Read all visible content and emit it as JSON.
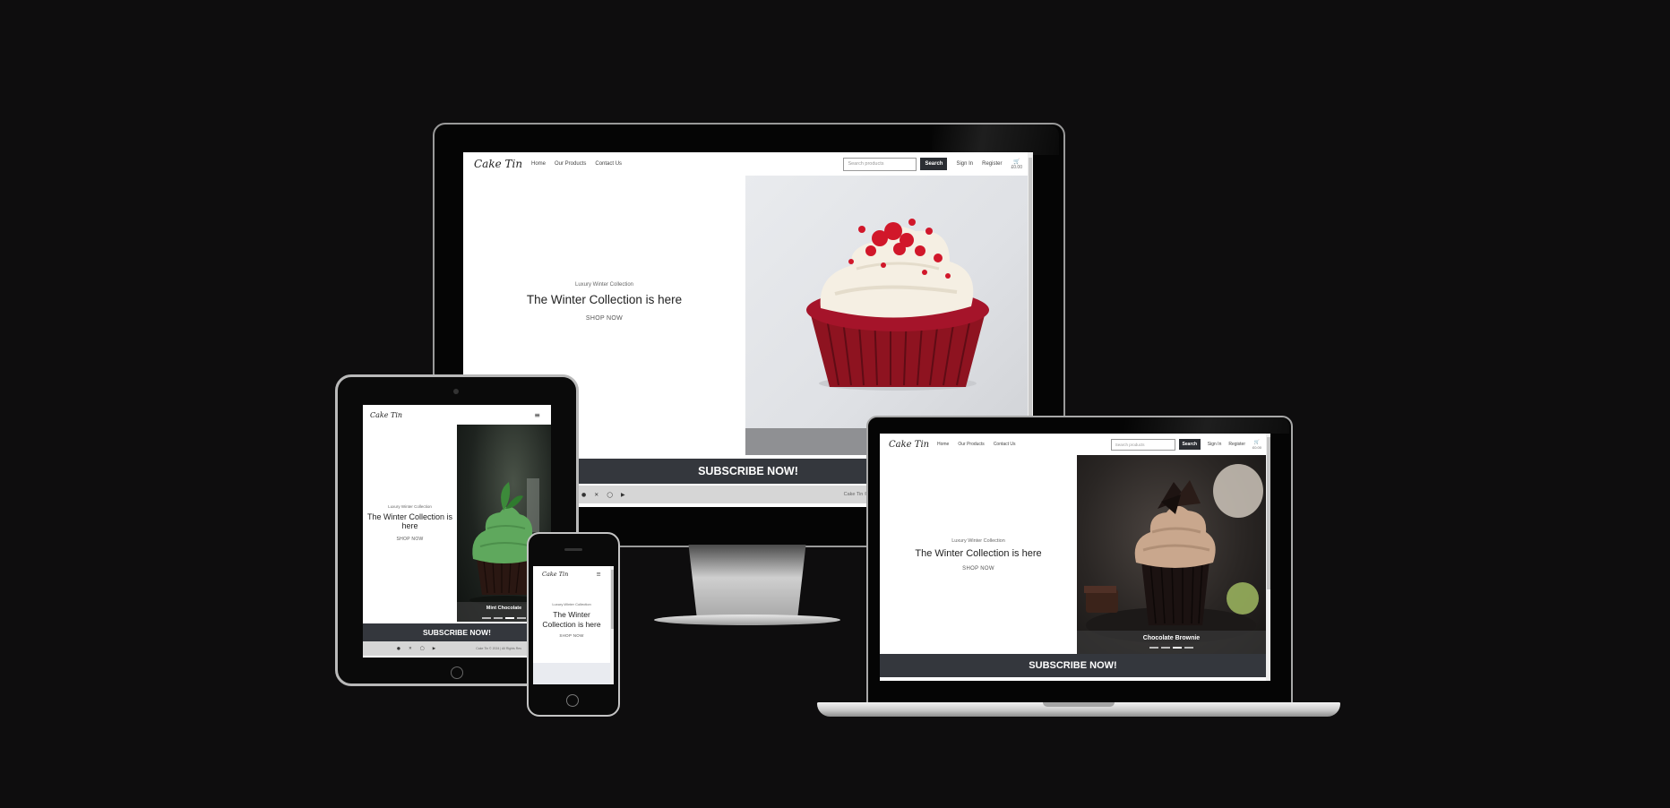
{
  "site": {
    "logo": "Cake Tin",
    "nav": [
      "Home",
      "Our Products",
      "Contact Us"
    ],
    "search_placeholder": "Search products",
    "search_button": "Search",
    "sign_in": "Sign In",
    "register": "Register",
    "basket_total": "£0.00",
    "kicker": "Luxury Winter Collection",
    "headline": "The Winter Collection is here",
    "cta": "SHOP NOW",
    "subscribe": "SUBSCRIBE NOW!",
    "copyright_desktop": "Cake Tin ©",
    "copyright_tablet": "Cake Tin © 2024 | All Rights Res",
    "menu_icon": "≡"
  },
  "slides": {
    "tablet_caption": "Mint Chocolate",
    "laptop_caption": "Chocolate Brownie"
  },
  "icons": [
    "facebook-icon",
    "x-icon",
    "instagram-icon",
    "youtube-icon",
    "basket-icon",
    "hamburger-icon"
  ],
  "colors": {
    "background": "#0e0d0e",
    "subscribe_band": "#34373d",
    "search_button": "#2b2e33",
    "footer": "#d6d6d6"
  }
}
